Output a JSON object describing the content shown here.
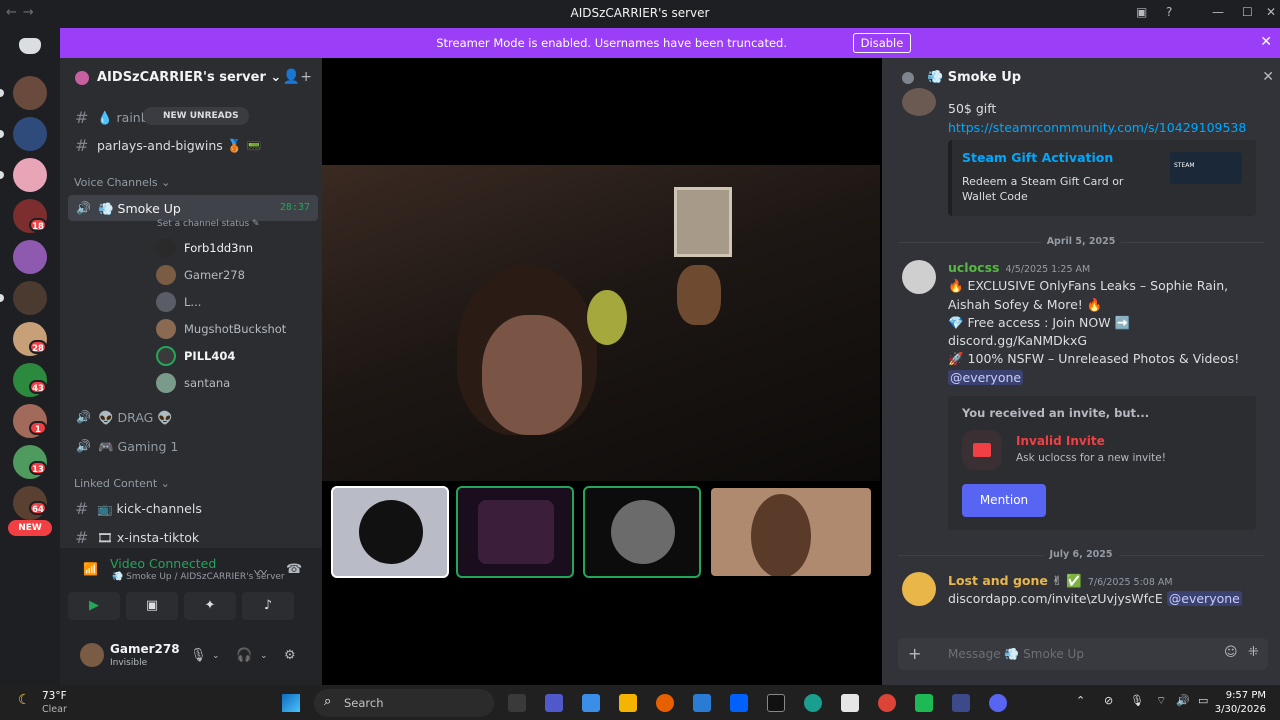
{
  "window": {
    "title": "AIDSzCARRIER's server"
  },
  "banner": {
    "text": "Streamer Mode is enabled. Usernames have been truncated.",
    "button": "Disable",
    "bg": "#9b3ef8"
  },
  "rail": {
    "badges": [
      "18",
      "28",
      "43",
      "1",
      "13",
      "64"
    ],
    "new_label": "NEW"
  },
  "sidebar": {
    "server_name": "AIDSzCARRIER's server",
    "text_channels": [
      "💧 rainb",
      "parlays-and-bigwins 🥉 📟"
    ],
    "new_unreads": "NEW UNREADS",
    "voice_category": "Voice Channels",
    "active_voice": {
      "name": "💨 Smoke Up",
      "time": "28:37",
      "status_hint": "Set a channel status"
    },
    "voice_users": [
      "Forb1dd3nn",
      "Gamer278",
      "L...",
      "MugshotBuckshot",
      "PILL404",
      "santana"
    ],
    "other_voice": [
      "👽 DRAG 👽",
      "🎮 Gaming 1"
    ],
    "linked_category": "Linked Content",
    "linked_channels": [
      "📺 kick-channels",
      "🎞 x-insta-tiktok"
    ]
  },
  "voice_panel": {
    "title": "Video Connected",
    "subtitle": "💨 Smoke Up / AIDSzCARRIER's server",
    "accent": "#23a55a"
  },
  "user_panel": {
    "name": "Gamer278",
    "status": "Invisible"
  },
  "chat": {
    "header": "💨 Smoke Up",
    "msg1": {
      "text": "50$ gift",
      "link": "https://steamrconmmunity.com/s/10429109538",
      "embed_title": "Steam Gift Activation",
      "embed_desc": "Redeem a Steam Gift Card or Wallet Code",
      "embed_logo": "STEAM"
    },
    "date1": "April 5, 2025",
    "msg2": {
      "author": "uclocss",
      "time": "4/5/2025 1:25 AM",
      "line1": "🔥 EXCLUSIVE OnlyFans Leaks – Sophie Rain, Aishah Sofey & More! 🔥",
      "line2": "💎 Free access : Join NOW ➡️",
      "line3": "discord.gg/KaNMDkxG",
      "line4": "🚀 100% NSFW – Unreleased Photos & Videos!",
      "mention": "@everyone",
      "author_color": "#57b843"
    },
    "invite": {
      "header": "You received an invite, but...",
      "title": "Invalid Invite",
      "subtitle": "Ask uclocss for a new invite!",
      "button": "Mention"
    },
    "date2": "July 6, 2025",
    "msg3": {
      "author": "Lost and gone",
      "badges": "✌ ✅",
      "time": "7/6/2025 5:08 AM",
      "text": "discordapp.com/invite\\zUvjysWfcE",
      "mention": "@everyone",
      "author_color": "#e9b64a"
    },
    "composer_placeholder": "Message 💨 Smoke Up"
  },
  "taskbar": {
    "weather_temp": "73°F",
    "weather_desc": "Clear",
    "search": "Search",
    "time": "9:57 PM",
    "date": "3/30/2026"
  }
}
